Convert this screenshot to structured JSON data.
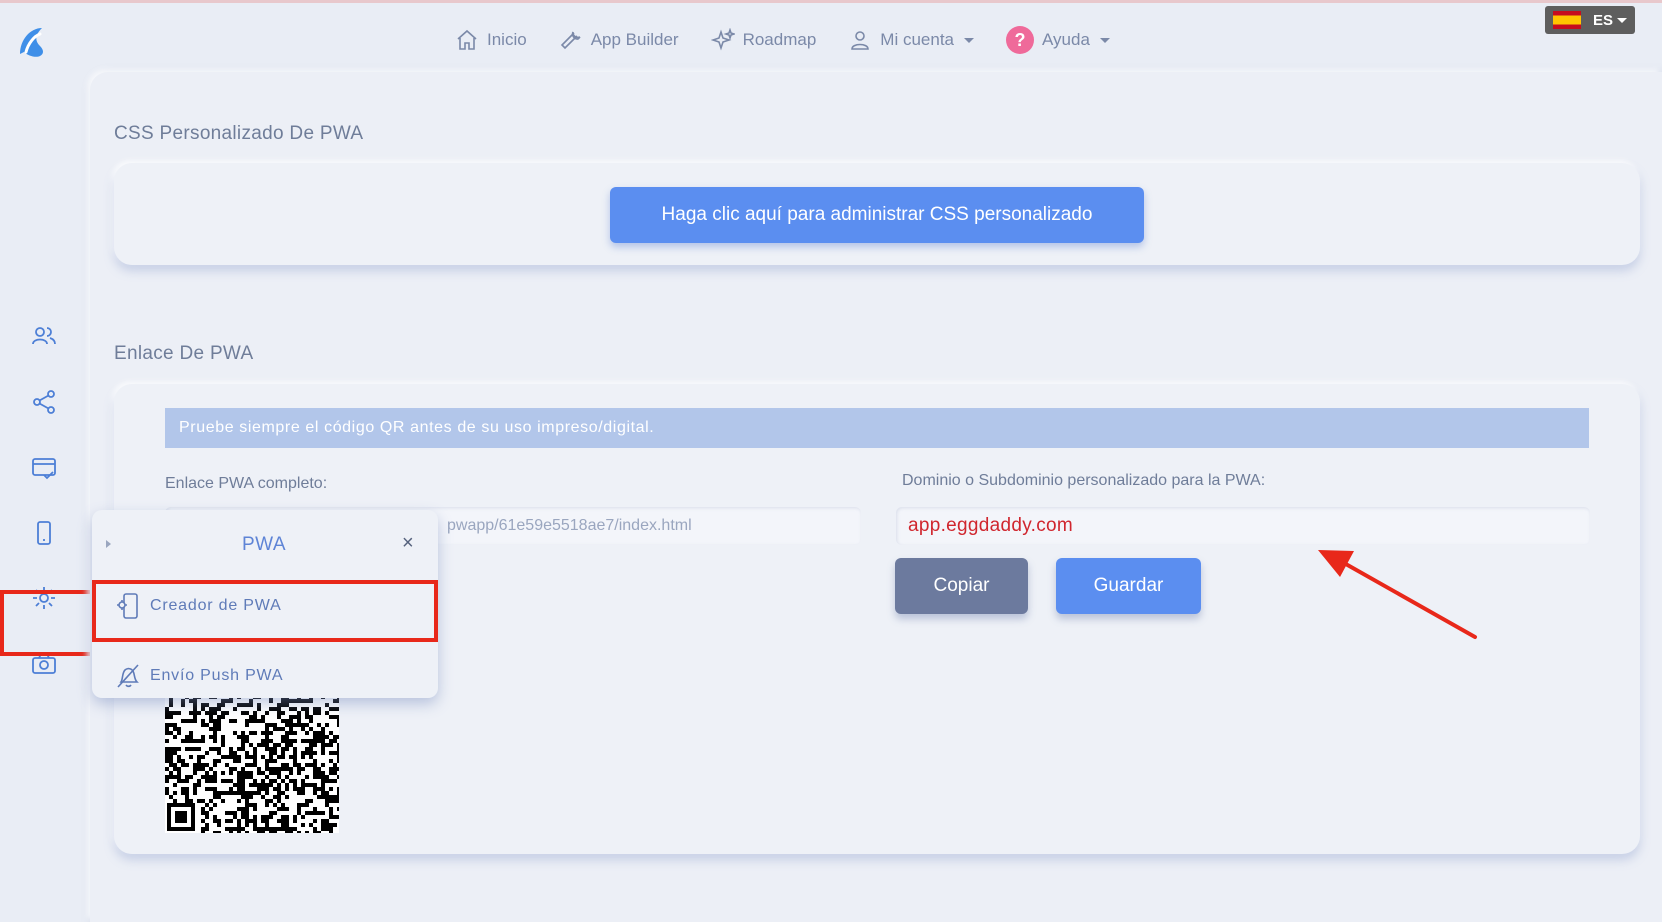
{
  "header": {
    "nav": [
      {
        "label": "Inicio",
        "icon": "home-icon"
      },
      {
        "label": "App Builder",
        "icon": "wrench-icon"
      },
      {
        "label": "Roadmap",
        "icon": "sparkle-icon"
      },
      {
        "label": "Mi cuenta",
        "icon": "user-icon",
        "dropdown": true
      },
      {
        "label": "Ayuda",
        "icon": "help-icon",
        "dropdown": true
      }
    ],
    "help_glyph": "?",
    "language": "ES"
  },
  "sidebar": {
    "icons": [
      "users-icon",
      "share-icon",
      "payment-card-icon",
      "mobile-phone-icon",
      "gear-icon",
      "camera-icon"
    ],
    "active": "mobile-phone-icon"
  },
  "css_section": {
    "title": "CSS Personalizado De PWA",
    "button_label": "Haga clic aquí para administrar CSS personalizado"
  },
  "link_section": {
    "title": "Enlace De PWA",
    "alert_text": "Pruebe siempre el código QR antes de su uso impreso/digital.",
    "full_link_label": "Enlace PWA completo:",
    "full_link_value": "pwapp/61e59e5518ae7/index.html",
    "domain_label": "Dominio o Subdominio personalizado para la PWA:",
    "domain_value": "app.eggdaddy.com",
    "copy_label": "Copiar",
    "save_label": "Guardar"
  },
  "popup": {
    "title": "PWA",
    "close_glyph": "×",
    "items": [
      {
        "label": "Creador de PWA",
        "icon": "mobile-gear-icon"
      },
      {
        "label": "Envío Push PWA",
        "icon": "bell-icon"
      }
    ]
  },
  "colors": {
    "accent": "#5b8ef0",
    "secondary": "#6c7a9e",
    "highlight": "#e8281a",
    "domain_text": "#d0262e"
  }
}
